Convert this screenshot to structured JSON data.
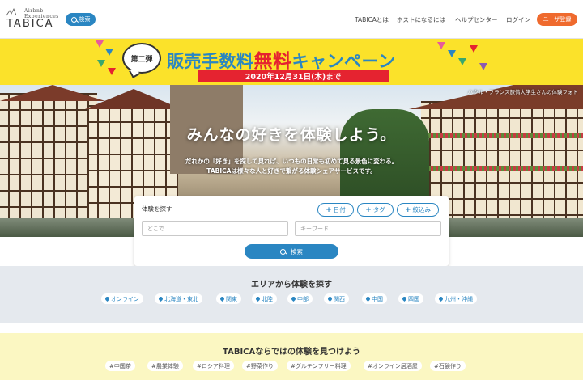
{
  "header": {
    "logo_text": "TABICA",
    "logo_sub": "Airbnb Experiences",
    "search_label": "検索",
    "nav": [
      "TABICAとは",
      "ホストになるには",
      "ヘルプセンター",
      "ログイン"
    ],
    "register_label": "ユーザ登録"
  },
  "banner": {
    "badge": "第二弾",
    "title_part1": "販売手数料",
    "title_part2": "無料",
    "title_part3": "キャンペーン",
    "deadline": "2020年12月31日(木)まで"
  },
  "hero": {
    "credit": "ハウル・フランス旅情大学生さんの体験フォト",
    "title": "みんなの好きを体験しよう。",
    "sub1": "だれかの「好き」を探して見れば、いつもの日常も初めて見る景色に変わる。",
    "sub2": "TABICAは様々な人と好きで繋がる体験シェアサービスです。"
  },
  "search_panel": {
    "label": "体験を探す",
    "date_button": "日付",
    "tag_button": "タグ",
    "filter_button": "絞込み",
    "where_placeholder": "どこで",
    "keyword_placeholder": "キーワード",
    "submit_label": "検索"
  },
  "area_section": {
    "title": "エリアから体験を探す",
    "items": [
      "オンライン",
      "北海道・東北",
      "関東",
      "北陸",
      "中部",
      "関西",
      "中国",
      "四国",
      "九州・沖縄"
    ]
  },
  "tag_section": {
    "title": "TABICAならではの体験を見つけよう",
    "items": [
      "#中国茶",
      "#農業体験",
      "#ロシア料理",
      "#野菜作り",
      "#グルテンフリー料理",
      "#オンライン居酒屋",
      "#石鹸作り"
    ]
  },
  "colors": {
    "accent": "#2a86c2",
    "register": "#ef6a2e",
    "banner_bg": "#fbe22a",
    "banner_red": "#e52330",
    "area_bg": "#e5e9ee",
    "tag_bg": "#fbf7c2"
  }
}
